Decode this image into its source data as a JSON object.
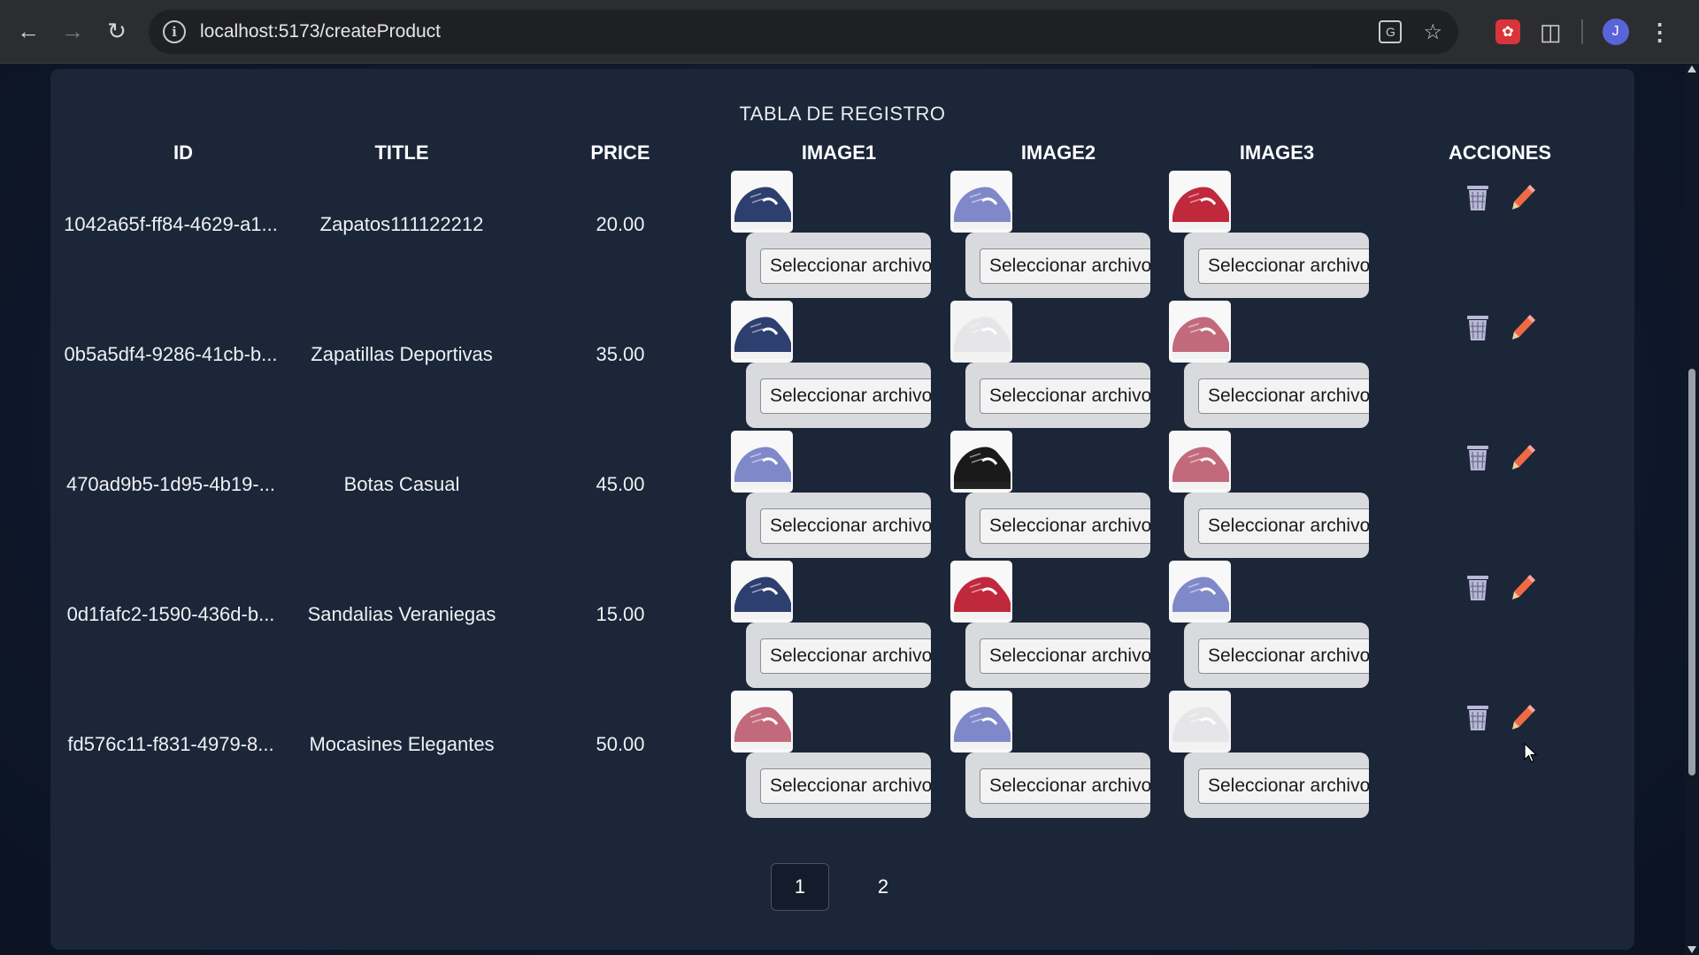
{
  "browser": {
    "url": "localhost:5173/createProduct",
    "avatar_letter": "J",
    "icons": [
      "back-icon",
      "forward-icon",
      "reload-icon",
      "site-info-icon",
      "translate-icon",
      "bookmark-star-icon",
      "extension-icon",
      "puzzle-icon",
      "avatar",
      "kebab-menu-icon"
    ]
  },
  "table": {
    "caption": "TABLA DE REGISTRO",
    "headers": [
      "ID",
      "TITLE",
      "PRICE",
      "IMAGE1",
      "IMAGE2",
      "IMAGE3",
      "ACCIONES"
    ],
    "file_button_label": "Seleccionar archivo",
    "rows": [
      {
        "id": "1042a65f-ff84-4629-a1...",
        "title": "Zapatos111122212",
        "price": "20.00",
        "images": [
          "navy",
          "blue",
          "red"
        ]
      },
      {
        "id": "0b5a5df4-9286-41cb-b...",
        "title": "Zapatillas Deportivas",
        "price": "35.00",
        "images": [
          "navy",
          "white",
          "pink"
        ]
      },
      {
        "id": "470ad9b5-1d95-4b19-...",
        "title": "Botas Casual",
        "price": "45.00",
        "images": [
          "blue",
          "black",
          "pink"
        ]
      },
      {
        "id": "0d1fafc2-1590-436d-b...",
        "title": "Sandalias Veraniegas",
        "price": "15.00",
        "images": [
          "navy",
          "red",
          "blue"
        ]
      },
      {
        "id": "fd576c11-f831-4979-8...",
        "title": "Mocasines Elegantes",
        "price": "50.00",
        "images": [
          "pink",
          "blue",
          "white"
        ]
      }
    ]
  },
  "pagination": {
    "pages": [
      "1",
      "2"
    ],
    "current": "1"
  },
  "colors": {
    "page_bg": "#0d1526",
    "card_bg": "#1b2638",
    "shoe_navy": "#2d3f6e",
    "shoe_blue": "#7f88c9",
    "shoe_red": "#c0283c",
    "shoe_pink": "#c26a7c",
    "shoe_white": "#e6e6e8",
    "shoe_black": "#1a1a1a",
    "trash": "#b9b8d6",
    "pencil": "#ef6a45"
  }
}
